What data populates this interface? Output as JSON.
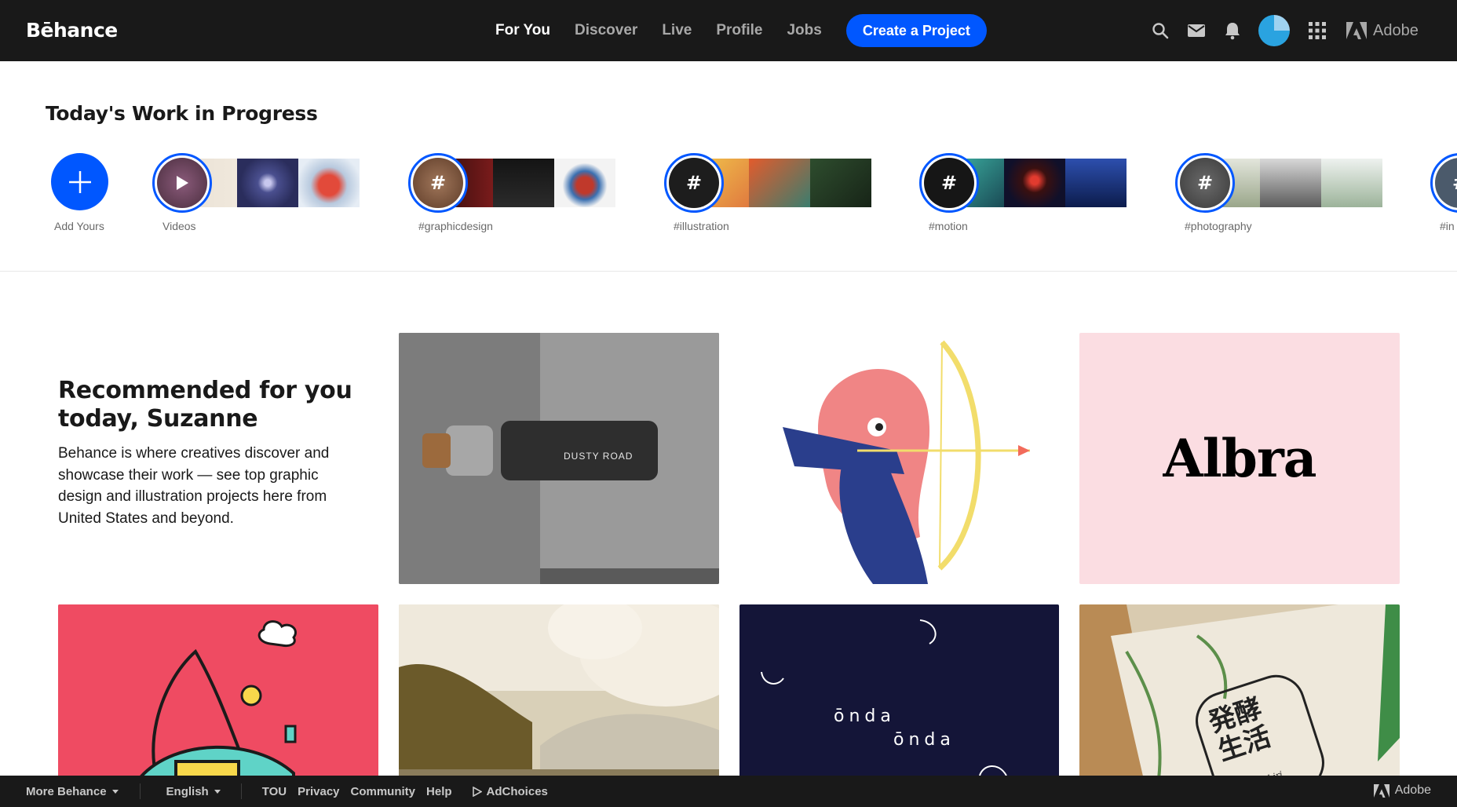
{
  "header": {
    "logo": "Bēhance",
    "nav": [
      {
        "label": "For You",
        "active": true
      },
      {
        "label": "Discover",
        "active": false
      },
      {
        "label": "Live",
        "active": false
      },
      {
        "label": "Profile",
        "active": false
      },
      {
        "label": "Jobs",
        "active": false
      }
    ],
    "create_label": "Create a Project",
    "icons": [
      "search-icon",
      "mail-icon",
      "bell-icon",
      "avatar",
      "apps-grid-icon"
    ],
    "adobe_label": "Adobe"
  },
  "wip": {
    "title": "Today's Work in Progress",
    "add_label": "Add Yours",
    "stories": [
      {
        "label": "Videos",
        "type": "play"
      },
      {
        "label": "#graphicdesign",
        "type": "hash"
      },
      {
        "label": "#illustration",
        "type": "hash"
      },
      {
        "label": "#motion",
        "type": "hash"
      },
      {
        "label": "#photography",
        "type": "hash"
      },
      {
        "label": "#in",
        "type": "hash"
      }
    ]
  },
  "recommended": {
    "title": "Recommended for you today, Suzanne",
    "description": "Behance is where creatives discover and showcase their work — see top graphic design and illustration projects here from United States and beyond.",
    "cards": [
      {
        "text": "DUSTY ROAD"
      },
      {
        "text": ""
      },
      {
        "text": "Albra"
      },
      {
        "text": ""
      },
      {
        "text": ""
      },
      {
        "text": "ōnda",
        "text2": "ōnda"
      },
      {
        "text": "発酵生活",
        "text2": "by Nishiri"
      }
    ]
  },
  "footer": {
    "more_label": "More Behance",
    "language": "English",
    "links": [
      "TOU",
      "Privacy",
      "Community",
      "Help"
    ],
    "adchoices": "AdChoices",
    "adobe_label": "Adobe"
  },
  "colors": {
    "accent": "#0057ff",
    "header_bg": "#191919"
  }
}
